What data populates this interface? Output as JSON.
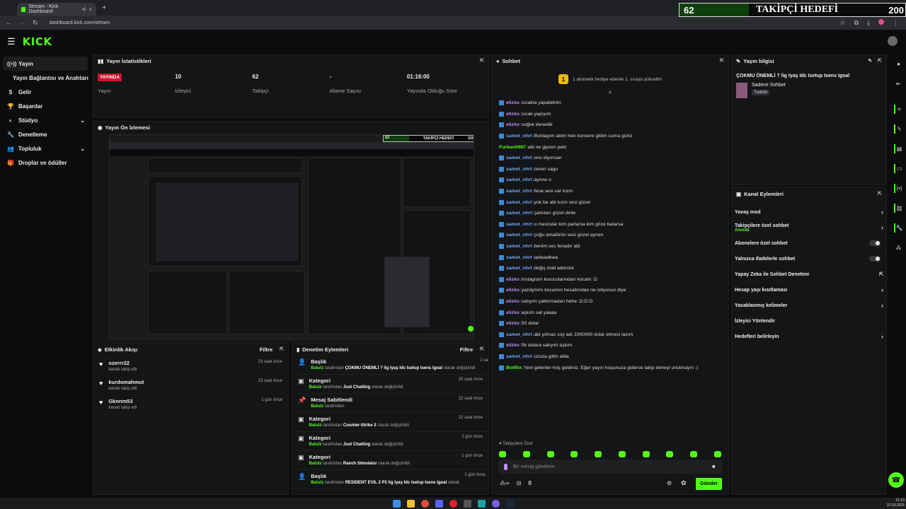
{
  "browser": {
    "tab_title": "Stream - Kick Dashboard",
    "url": "dashboard.kick.com/stream"
  },
  "overlay_goal": {
    "count": "62",
    "label": "TAKİPÇİ HEDEFİ",
    "target": "200"
  },
  "brand": {
    "logo": "KICK",
    "accent": "#53fc18"
  },
  "sidebar": {
    "items": [
      {
        "label": "Yayın",
        "icon": "broadcast-icon"
      },
      {
        "label": "Yayın Bağlantısı ve Anahtarı"
      },
      {
        "label": "Gelir",
        "icon": "dollar-icon"
      },
      {
        "label": "Başarılar",
        "icon": "trophy-icon"
      },
      {
        "label": "Stüdyo",
        "icon": "palette-icon"
      },
      {
        "label": "Denetleme",
        "icon": "wrench-icon"
      },
      {
        "label": "Topluluk",
        "icon": "people-icon"
      },
      {
        "label": "Droplar ve ödüller",
        "icon": "gift-icon"
      }
    ]
  },
  "stats": {
    "title": "Yayın İstatistikleri",
    "live_badge": "YAYINDA",
    "live_label": "Yayın",
    "viewers": "10",
    "viewers_label": "İzleyici",
    "followers": "62",
    "followers_label": "Takipçi",
    "subs": "-",
    "subs_label": "Abone Sayısı",
    "uptime": "01:16:00",
    "uptime_label": "Yayında Olduğu Süre"
  },
  "preview": {
    "title": "Yayın Ön İzlemesi",
    "mini_goal_count": "62",
    "mini_goal_label": "TAKİPÇİ HEDEFİ",
    "mini_goal_target": "200"
  },
  "activity": {
    "title": "Etkinlik Akışı",
    "filter": "Filtre",
    "items": [
      {
        "name": "ozerrr22",
        "action": "kanalı takip etti",
        "time": "23 saat önce"
      },
      {
        "name": "kurdomahmut",
        "action": "kanalı takip etti",
        "time": "23 saat önce"
      },
      {
        "name": "Gknnm53",
        "action": "kanalı takip etti",
        "time": "1 gün önce"
      }
    ]
  },
  "moderation": {
    "title": "Denetim Eylemleri",
    "filter": "Filtre",
    "items": [
      {
        "title": "Başlık",
        "user": "Batulz",
        "mid": " tarafından ",
        "value": "ÇOKMU ÖNEMLİ ? lig Iyaş Idc Isetup Isens Igoal",
        "end": " olarak değiştirildi",
        "time": "1 saat önce",
        "icon": "person-icon"
      },
      {
        "title": "Kategori",
        "user": "Batulz",
        "mid": " tarafından ",
        "value": "Just Chatting",
        "end": " olarak değiştirildi",
        "time": "20 saat önce",
        "icon": "category-icon"
      },
      {
        "title": "Mesaj Sabitlendi",
        "user": "Batulz",
        "mid": " tarafından",
        "value": "",
        "end": "",
        "time": "22 saat önce",
        "icon": "pin-icon"
      },
      {
        "title": "Kategori",
        "user": "Batulz",
        "mid": " tarafından ",
        "value": "Counter-Strike 2",
        "end": " olarak değiştirildi",
        "time": "22 saat önce",
        "icon": "category-icon"
      },
      {
        "title": "Kategori",
        "user": "Batulz",
        "mid": " tarafından ",
        "value": "Just Chatting",
        "end": " olarak değiştirildi",
        "time": "1 gün önce",
        "icon": "category-icon"
      },
      {
        "title": "Kategori",
        "user": "Batulz",
        "mid": " tarafından ",
        "value": "Ranch Simulator",
        "end": " olarak değiştirildi",
        "time": "1 gün önce",
        "icon": "category-icon"
      },
      {
        "title": "Başlık",
        "user": "Batulz",
        "mid": " tarafından ",
        "value": "RESIDENT EVIL 2 P2 lig Iyaş Idc Isetup Isens Igoal",
        "end": " olarak",
        "time": "1 gün önce",
        "icon": "person-icon"
      }
    ]
  },
  "chat": {
    "title": "Sohbet",
    "gift_banner": "1 abonelik hediye ederek 1. sıraya yükseltin",
    "gift_badge": "1",
    "messages": [
      {
        "user": "elizko",
        "text": "sıcakta yapabilirim",
        "color": "#c08cf5",
        "badge": true
      },
      {
        "user": "elizko",
        "text": "sıcak yapıyım",
        "color": "#c08cf5",
        "badge": true
      },
      {
        "user": "elizko",
        "text": "soğuk denedik",
        "color": "#c08cf5",
        "badge": true
      },
      {
        "user": "samet_nhrt",
        "text": "Burdayım abim hee konsere gittim cuma günü",
        "color": "#6fa8f5",
        "badge": true
      },
      {
        "user": "Furkan0987",
        "text": "abi ne giycen peki",
        "color": "#53fc18",
        "badge": false
      },
      {
        "user": "samet_nhrt",
        "text": "onu diyorsan",
        "color": "#6fa8f5",
        "badge": true
      },
      {
        "user": "samet_nhrt",
        "text": "ceren sagu",
        "color": "#6fa8f5",
        "badge": true
      },
      {
        "user": "samet_nhrt",
        "text": "aynne o",
        "color": "#6fa8f5",
        "badge": true
      },
      {
        "user": "samet_nhrt",
        "text": "fena sesi var kızın",
        "color": "#6fa8f5",
        "badge": true
      },
      {
        "user": "samet_nhrt",
        "text": "yok be abi kızın sesi güzel",
        "color": "#6fa8f5",
        "badge": true
      },
      {
        "user": "samet_nhrt",
        "text": "şarkıları güzel dinle",
        "color": "#6fa8f5",
        "badge": true
      },
      {
        "user": "samet_nhrt",
        "text": "o mevzular kim parlarsa kim göze batarsa",
        "color": "#6fa8f5",
        "badge": true
      },
      {
        "user": "samet_nhrt",
        "text": "çoğu amatörün sesi güzel aynen",
        "color": "#6fa8f5",
        "badge": true
      },
      {
        "user": "samet_nhrt",
        "text": "benim ses fenadır abi",
        "color": "#6fa8f5",
        "badge": true
      },
      {
        "user": "samet_nhrt",
        "text": "iadwadkwa",
        "color": "#6fa8f5",
        "badge": true
      },
      {
        "user": "samet_nhrt",
        "text": "değiş mail adersini",
        "color": "#6fa8f5",
        "badge": true
      },
      {
        "user": "elizko",
        "text": "instagram kurucularından kocam :D",
        "color": "#c08cf5",
        "badge": true
      },
      {
        "user": "elizko",
        "text": "yazılymmı kocamın hesabından ne istiyosun diye",
        "color": "#c08cf5",
        "badge": true
      },
      {
        "user": "elizko",
        "text": "satıyım çaktırmadan hehe :D:D:D",
        "color": "#c08cf5",
        "badge": true
      },
      {
        "user": "elizko",
        "text": "aşkım sat yaaaa",
        "color": "#c08cf5",
        "badge": true
      },
      {
        "user": "elizko",
        "text": "50 dolar",
        "color": "#c08cf5",
        "badge": true
      },
      {
        "user": "samet_nhrt",
        "text": "abi yılmaz soy adı 1000000 dolar etmesi lazım",
        "color": "#6fa8f5",
        "badge": true
      },
      {
        "user": "elizko",
        "text": "5k dolara satıyım aşkım",
        "color": "#c08cf5",
        "badge": true
      },
      {
        "user": "samet_nhrt",
        "text": "ucuza gittin abla",
        "color": "#6fa8f5",
        "badge": true
      },
      {
        "user": "BotRix",
        "text": "Yeni gelenler hoş geldiniz. Eğer yayın hoşunuza giderse takip etmeyi unutmayın :)",
        "color": "#53fc18",
        "badge": true
      }
    ],
    "followers_only": "Takipçilere Özel",
    "input_placeholder": "Bir mesaj gönderin",
    "points": "0",
    "send": "Gönder"
  },
  "stream_info": {
    "title": "Yayın bilgisi",
    "stream_title": "ÇOKMU ÖNEMLİ ? lig Iyaş Idc Isetup Isens Igoal",
    "category": "Sadece Sohbet",
    "language": "Turkish"
  },
  "channel_actions": {
    "title": "Kanal Eylemleri",
    "items": [
      {
        "label": "Yavaş mod",
        "type": "arrow"
      },
      {
        "label": "Takipçilere özel sohbet",
        "sub": "Anında",
        "type": "arrow"
      },
      {
        "label": "Abonelere özel sohbet",
        "type": "toggle"
      },
      {
        "label": "Yalnızca ifadelerle sohbet",
        "type": "toggle"
      },
      {
        "label": "Yapay Zeka ile Sohbet Denetimi",
        "type": "link"
      },
      {
        "label": "Hesap yaşı kısıtlaması",
        "type": "arrow"
      },
      {
        "label": "Yasaklanmış kelimeler",
        "type": "arrow"
      },
      {
        "label": "İzleyici Yönlendir",
        "type": "none"
      },
      {
        "label": "Hedefleri belirleyin",
        "type": "arrow"
      }
    ]
  },
  "clock": {
    "time": "21:53",
    "date": "22.03.2025"
  }
}
